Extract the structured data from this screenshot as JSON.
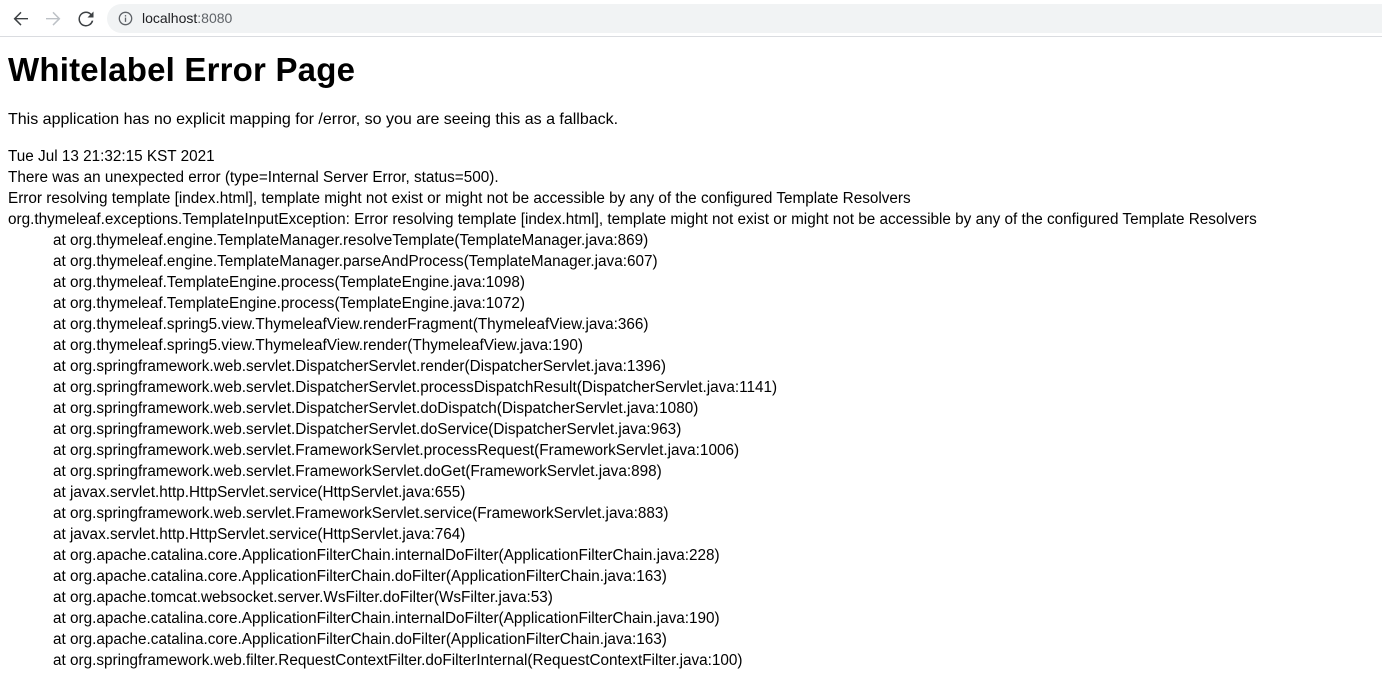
{
  "browser": {
    "url_host": "localhost",
    "url_port": ":8080"
  },
  "page": {
    "title": "Whitelabel Error Page",
    "fallback_message": "This application has no explicit mapping for /error, so you are seeing this as a fallback.",
    "timestamp": "Tue Jul 13 21:32:15 KST 2021",
    "error_summary": "There was an unexpected error (type=Internal Server Error, status=500).",
    "error_message": "Error resolving template [index.html], template might not exist or might not be accessible by any of the configured Template Resolvers",
    "exception": "org.thymeleaf.exceptions.TemplateInputException: Error resolving template [index.html], template might not exist or might not be accessible by any of the configured Template Resolvers",
    "stack_trace": [
      "at org.thymeleaf.engine.TemplateManager.resolveTemplate(TemplateManager.java:869)",
      "at org.thymeleaf.engine.TemplateManager.parseAndProcess(TemplateManager.java:607)",
      "at org.thymeleaf.TemplateEngine.process(TemplateEngine.java:1098)",
      "at org.thymeleaf.TemplateEngine.process(TemplateEngine.java:1072)",
      "at org.thymeleaf.spring5.view.ThymeleafView.renderFragment(ThymeleafView.java:366)",
      "at org.thymeleaf.spring5.view.ThymeleafView.render(ThymeleafView.java:190)",
      "at org.springframework.web.servlet.DispatcherServlet.render(DispatcherServlet.java:1396)",
      "at org.springframework.web.servlet.DispatcherServlet.processDispatchResult(DispatcherServlet.java:1141)",
      "at org.springframework.web.servlet.DispatcherServlet.doDispatch(DispatcherServlet.java:1080)",
      "at org.springframework.web.servlet.DispatcherServlet.doService(DispatcherServlet.java:963)",
      "at org.springframework.web.servlet.FrameworkServlet.processRequest(FrameworkServlet.java:1006)",
      "at org.springframework.web.servlet.FrameworkServlet.doGet(FrameworkServlet.java:898)",
      "at javax.servlet.http.HttpServlet.service(HttpServlet.java:655)",
      "at org.springframework.web.servlet.FrameworkServlet.service(FrameworkServlet.java:883)",
      "at javax.servlet.http.HttpServlet.service(HttpServlet.java:764)",
      "at org.apache.catalina.core.ApplicationFilterChain.internalDoFilter(ApplicationFilterChain.java:228)",
      "at org.apache.catalina.core.ApplicationFilterChain.doFilter(ApplicationFilterChain.java:163)",
      "at org.apache.tomcat.websocket.server.WsFilter.doFilter(WsFilter.java:53)",
      "at org.apache.catalina.core.ApplicationFilterChain.internalDoFilter(ApplicationFilterChain.java:190)",
      "at org.apache.catalina.core.ApplicationFilterChain.doFilter(ApplicationFilterChain.java:163)",
      "at org.springframework.web.filter.RequestContextFilter.doFilterInternal(RequestContextFilter.java:100)"
    ]
  }
}
